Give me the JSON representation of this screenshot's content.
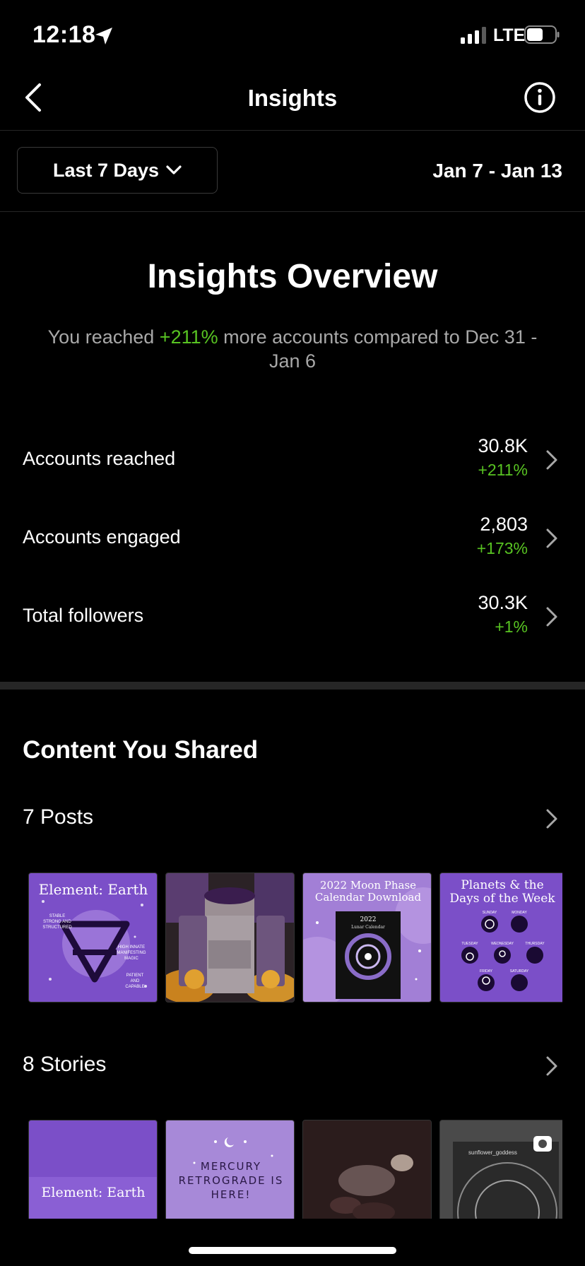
{
  "status_bar": {
    "time": "12:18",
    "network": "LTE",
    "icons": [
      "location-arrow-icon",
      "signal-icon",
      "battery-icon"
    ]
  },
  "header": {
    "title": "Insights",
    "icons": [
      "back-chevron-icon",
      "info-icon"
    ]
  },
  "filter": {
    "range_label": "Last 7 Days",
    "date_range": "Jan 7 - Jan 13"
  },
  "overview": {
    "title": "Insights Overview",
    "summary_prefix": "You reached ",
    "summary_highlight": "+211%",
    "summary_suffix": " more accounts compared to Dec 31 - Jan 6"
  },
  "metrics": [
    {
      "label": "Accounts reached",
      "value": "30.8K",
      "change": "+211%"
    },
    {
      "label": "Accounts engaged",
      "value": "2,803",
      "change": "+173%"
    },
    {
      "label": "Total followers",
      "value": "30.3K",
      "change": "+1%"
    }
  ],
  "content": {
    "title": "Content You Shared",
    "posts_label": "7 Posts",
    "stories_label": "8 Stories",
    "posts": [
      {
        "title": "Element: Earth",
        "small": [
          "STABLE",
          "STRONG AND",
          "STRUCTURED",
          "HIGH INNATE",
          "MANIFESTING",
          "MAGIC",
          "PATIENT",
          "AND",
          "CAPABLE"
        ]
      },
      {
        "title": ""
      },
      {
        "title": "2022 Moon Phase Calendar Download",
        "inner_title": "2022",
        "inner_sub": "Lunar Calendar"
      },
      {
        "title": "Planets & the Days of the Week",
        "days": [
          "SUNDAY",
          "MONDAY",
          "TUESDAY",
          "WEDNESDAY",
          "THURSDAY",
          "FRIDAY",
          "SATURDAY"
        ]
      }
    ],
    "stories": [
      {
        "title": "Element: Earth"
      },
      {
        "title": "MERCURY RETROGRADE IS HERE!"
      },
      {
        "title": ""
      },
      {
        "title": "sunflower_goddess"
      }
    ]
  },
  "colors": {
    "background": "#000000",
    "accent_green": "#58c322",
    "muted_text": "#a8a8a8",
    "divider": "#262626",
    "purple": "#7b4fc8",
    "light_purple": "#a27fd6"
  }
}
